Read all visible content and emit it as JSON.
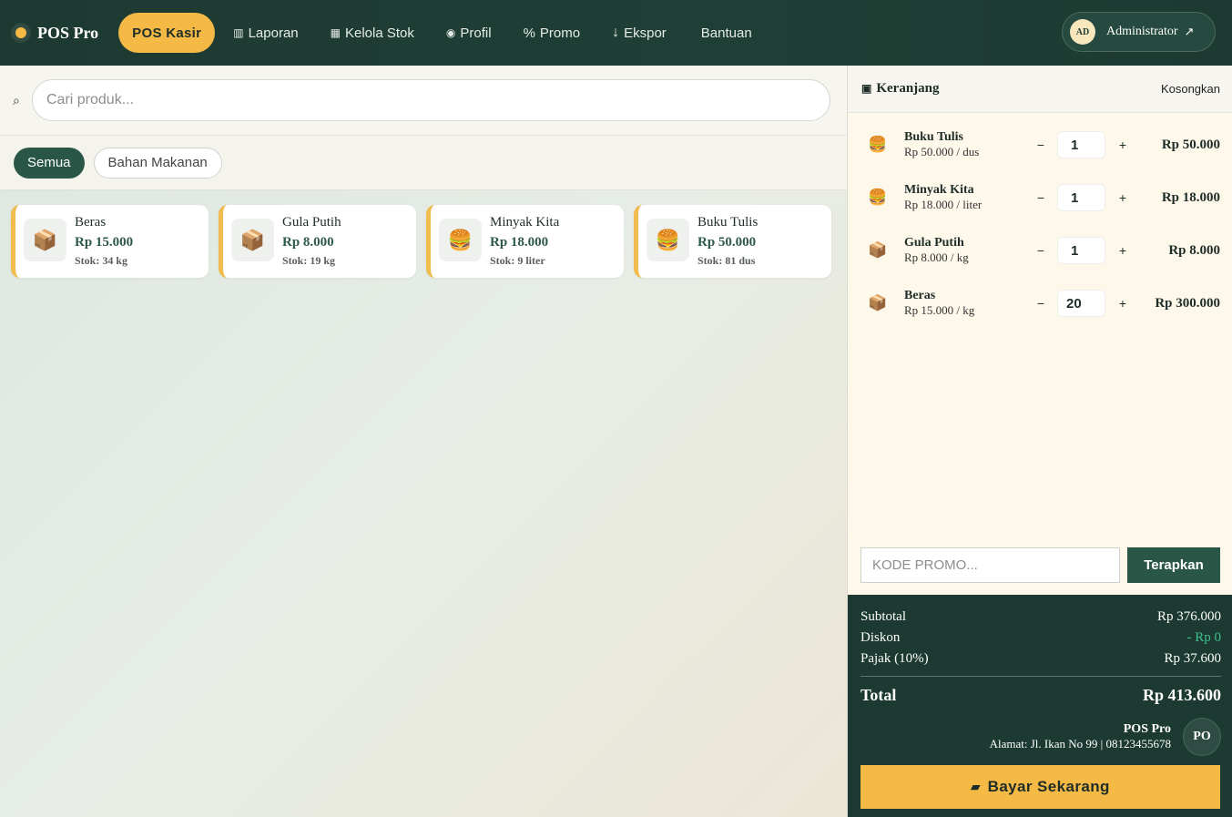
{
  "app": {
    "brand": "POS Pro"
  },
  "nav": {
    "active": "POS Kasir",
    "items": [
      {
        "icon": "▥",
        "label": "Laporan"
      },
      {
        "icon": "▦",
        "label": "Kelola Stok"
      },
      {
        "icon": "◉",
        "label": "Profil"
      },
      {
        "icon": "%",
        "label": "Promo"
      },
      {
        "icon": "↓",
        "label": "Ekspor"
      },
      {
        "icon": "",
        "label": "Bantuan"
      }
    ]
  },
  "user": {
    "initials": "AD",
    "name": "Administrator",
    "arrow": "↗"
  },
  "search": {
    "icon": "⌕",
    "placeholder": "Cari produk..."
  },
  "filters": {
    "all": "Semua",
    "food": "Bahan Makanan"
  },
  "products": [
    {
      "icon": "📦",
      "name": "Beras",
      "price": "Rp 15.000",
      "stock": "Stok: 34 kg"
    },
    {
      "icon": "📦",
      "name": "Gula Putih",
      "price": "Rp 8.000",
      "stock": "Stok: 19 kg"
    },
    {
      "icon": "🍔",
      "name": "Minyak Kita",
      "price": "Rp 18.000",
      "stock": "Stok: 9 liter"
    },
    {
      "icon": "🍔",
      "name": "Buku Tulis",
      "price": "Rp 50.000",
      "stock": "Stok: 81 dus"
    }
  ],
  "cart": {
    "title": "Keranjang",
    "title_icon": "▣",
    "clear": "Kosongkan",
    "items": [
      {
        "icon": "🍔",
        "name": "Buku Tulis",
        "unit": "Rp 50.000 / dus",
        "qty": "1",
        "total": "Rp 50.000"
      },
      {
        "icon": "🍔",
        "name": "Minyak Kita",
        "unit": "Rp 18.000 / liter",
        "qty": "1",
        "total": "Rp 18.000"
      },
      {
        "icon": "📦",
        "name": "Gula Putih",
        "unit": "Rp 8.000 / kg",
        "qty": "1",
        "total": "Rp 8.000"
      },
      {
        "icon": "📦",
        "name": "Beras",
        "unit": "Rp 15.000 / kg",
        "qty": "20",
        "total": "Rp 300.000"
      }
    ],
    "minus": "−",
    "plus": "+",
    "promo_placeholder": "KODE PROMO...",
    "promo_button": "Terapkan"
  },
  "summary": {
    "subtotal_label": "Subtotal",
    "subtotal": "Rp 376.000",
    "discount_label": "Diskon",
    "discount": "- Rp 0",
    "tax_label": "Pajak (10%)",
    "tax": "Rp 37.600",
    "total_label": "Total",
    "total": "Rp 413.600",
    "store_name": "POS Pro",
    "store_address": "Alamat: Jl. Ikan No 99 | 08123455678",
    "store_logo": "PO",
    "pay_icon": "▰",
    "pay_label": "Bayar Sekarang"
  },
  "colors": {
    "primary": "#1c3a32",
    "accent": "#f5b945",
    "chip_active": "#2a5648",
    "discount": "#3ec28e"
  }
}
